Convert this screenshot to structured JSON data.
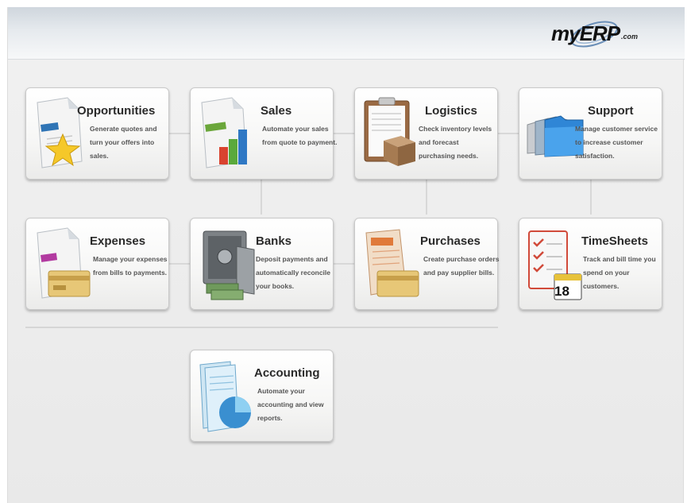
{
  "brand": {
    "logo_main": "my",
    "logo_accent": "ERP",
    "logo_suffix": ".com"
  },
  "modules": [
    {
      "id": "opportunities",
      "title": "Opportunities",
      "description": "Generate quotes and turn your offers into sales.",
      "icon": "quote-document-star-icon"
    },
    {
      "id": "sales",
      "title": "Sales",
      "description": "Automate your sales from quote to payment.",
      "icon": "invoice-bar-chart-icon"
    },
    {
      "id": "logistics",
      "title": "Logistics",
      "description": "Check inventory levels and forecast purchasing needs.",
      "icon": "clipboard-boxes-icon"
    },
    {
      "id": "support",
      "title": "Support",
      "description": "Manage customer service to increase customer satisfaction.",
      "icon": "folders-icon"
    },
    {
      "id": "expenses",
      "title": "Expenses",
      "description": "Manage your expenses from bills to payments.",
      "icon": "bill-credit-card-icon"
    },
    {
      "id": "banks",
      "title": "Banks",
      "description": "Deposit payments and automatically reconcile your books.",
      "icon": "safe-money-icon"
    },
    {
      "id": "purchases",
      "title": "Purchases",
      "description": "Create purchase orders and pay supplier bills.",
      "icon": "purchase-order-card-icon"
    },
    {
      "id": "timesheets",
      "title": "TimeSheets",
      "description": "Track and bill time you spend on your customers.",
      "icon": "checklist-calendar-icon"
    },
    {
      "id": "accounting",
      "title": "Accounting",
      "description": "Automate your accounting and view reports.",
      "icon": "reports-pie-chart-icon"
    }
  ],
  "calendar_day": "18",
  "colors": {
    "title": "#2a2a2a",
    "description": "#555555",
    "header_top": "#cfd6dd",
    "background": "#ececec"
  }
}
